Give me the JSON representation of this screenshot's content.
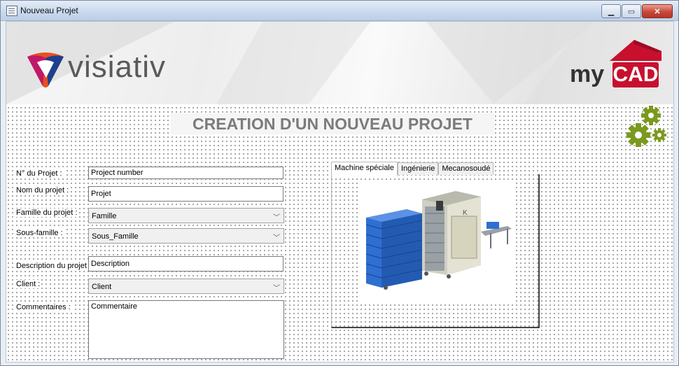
{
  "window": {
    "title": "Nouveau Projet"
  },
  "banner": {
    "brand_left": "visiativ",
    "brand_right_my": "my",
    "brand_right_cad": "CAD"
  },
  "heading": "CREATION D'UN NOUVEAU PROJET",
  "form": {
    "project_number": {
      "label": "N° du Projet :",
      "value": "Project number"
    },
    "project_name": {
      "label": "Nom du projet :",
      "value": "Projet"
    },
    "family": {
      "label": "Famille du projet :",
      "value": "Famille"
    },
    "subfamily": {
      "label": "Sous-famille :",
      "value": "Sous_Famille"
    },
    "description": {
      "label": "Description du projet :",
      "value": "Description"
    },
    "client": {
      "label": "Client :",
      "value": "Client"
    },
    "comments": {
      "label": "Commentaires :",
      "value": "Commentaire"
    }
  },
  "tabs": [
    {
      "label": "Machine spéciale",
      "active": true
    },
    {
      "label": "Ingénierie",
      "active": false
    },
    {
      "label": "Mecanosoudé",
      "active": false
    }
  ],
  "icons": {
    "window_icon": "form-icon",
    "gears": "gears-icon",
    "dropdown": "chevron-down-icon"
  },
  "colors": {
    "mycad_red": "#c8102e",
    "gear_green": "#7a9a1e",
    "heading_gray": "#7b7b7b"
  }
}
